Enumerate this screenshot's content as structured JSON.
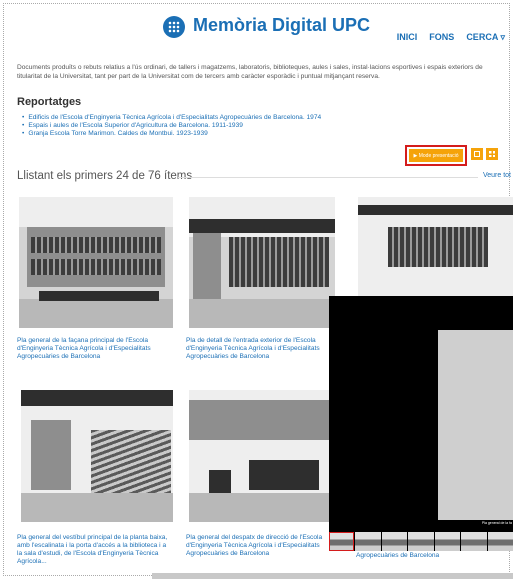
{
  "header": {
    "logo_text": "UPC",
    "title": "Memòria Digital UPC",
    "nav": [
      "INICI",
      "FONS",
      "CERCA ▿"
    ]
  },
  "description": "Documents produïts o rebuts relatius a l'ús ordinari, de tallers i magatzems, laboratoris, biblioteques, aules i sales, instal·lacions esportives i espais exteriors de titularitat de la Universitat, tant per part de la Universitat com de tercers amb caràcter esporàdic i puntual mitjançant reserva.",
  "reportatges": {
    "title": "Reportatges",
    "items": [
      "Edificis de l'Escola d'Enginyeria Tècnica Agrícola i d'Especialitats Agropecuàries de Barcelona. 1974",
      "Espais i aules de l'Escola Superior d'Agricultura de Barcelona. 1911-1939",
      "Granja Escola Torre Marimon. Caldes de Montbui. 1923-1939"
    ]
  },
  "toolbar": {
    "slideshow_label": "▶ Mode presentació",
    "list_view_icon": "list-view-icon",
    "grid_view_icon": "grid-view-icon"
  },
  "listing": {
    "title": "Llistant els primers 24 de 76 ítems",
    "see_all": "Veure tot"
  },
  "items": [
    {
      "caption": "Pla general de la façana principal de l'Escola d'Enginyeria Tècnica Agrícola i d'Especialitats Agropecuàries de Barcelona"
    },
    {
      "caption": "Pla de detall de l'entrada exterior de l'Escola d'Enginyeria Tècnica Agrícola i d'Especialitats Agropecuàries de Barcelona"
    },
    {
      "caption": ""
    },
    {
      "caption": "Pla general del vestíbul principal de la planta baixa, amb l'escalinata i la porta d'accés a la biblioteca i a la sala d'estudi, de l'Escola d'Enginyeria Tècnica Agrícola..."
    },
    {
      "caption": "Pla general del despatx de direcció de l'Escola d'Enginyeria Tècnica Agrícola i d'Especialitats Agropecuàries de Barcelona"
    },
    {
      "caption": "Agropecuàries de Barcelona"
    }
  ],
  "slideshow": {
    "caption": "Pla general de la fa"
  },
  "colors": {
    "brand": "#1b6fb5",
    "accent": "#f5a30a",
    "highlight": "#d41c1c"
  }
}
